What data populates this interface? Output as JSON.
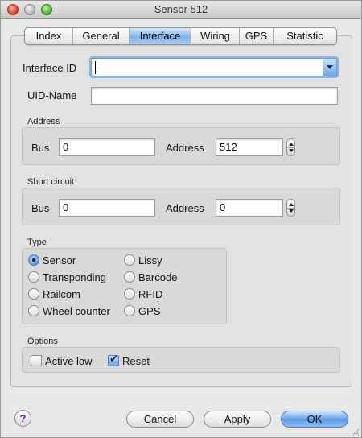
{
  "window": {
    "title": "Sensor 512"
  },
  "tabs": [
    {
      "label": "Index"
    },
    {
      "label": "General"
    },
    {
      "label": "Interface"
    },
    {
      "label": "Wiring"
    },
    {
      "label": "GPS"
    },
    {
      "label": "Statistic"
    }
  ],
  "active_tab": "Interface",
  "form": {
    "interface_id_label": "Interface ID",
    "interface_id_value": "",
    "uid_name_label": "UID-Name",
    "uid_name_value": ""
  },
  "address_group": {
    "title": "Address",
    "bus_label": "Bus",
    "bus_value": "0",
    "address_label": "Address",
    "address_value": "512"
  },
  "short_circuit_group": {
    "title": "Short circuit",
    "bus_label": "Bus",
    "bus_value": "0",
    "address_label": "Address",
    "address_value": "0"
  },
  "type_group": {
    "title": "Type",
    "options": [
      {
        "label": "Sensor",
        "selected": true
      },
      {
        "label": "Lissy",
        "selected": false
      },
      {
        "label": "Transponding",
        "selected": false
      },
      {
        "label": "Barcode",
        "selected": false
      },
      {
        "label": "Railcom",
        "selected": false
      },
      {
        "label": "RFID",
        "selected": false
      },
      {
        "label": "Wheel counter",
        "selected": false
      },
      {
        "label": "GPS",
        "selected": false
      }
    ]
  },
  "options_group": {
    "title": "Options",
    "active_low_label": "Active low",
    "active_low_checked": false,
    "reset_label": "Reset",
    "reset_checked": true
  },
  "buttons": {
    "help_label": "?",
    "cancel_label": "Cancel",
    "apply_label": "Apply",
    "ok_label": "OK"
  },
  "colors": {
    "accent": "#7db3ec",
    "help_icon": "#5a2d91"
  }
}
